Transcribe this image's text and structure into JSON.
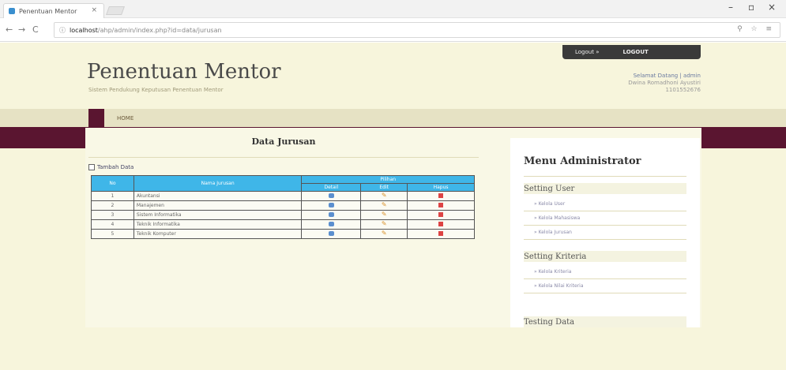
{
  "browser": {
    "tab_title": "Penentuan Mentor",
    "tab_close": "×",
    "url_host": "localhost",
    "url_path": "/ahp/admin/index.php?id=data/jurusan",
    "nav_back": "←",
    "nav_forward": "→",
    "nav_reload": "C",
    "info_icon": "ⓘ",
    "omni_icons": "⚲ ☆ ≡",
    "win_min": "–",
    "win_max": "▫",
    "win_close": "×"
  },
  "site": {
    "title": "Penentuan Mentor",
    "subtitle": "Sistem Pendukung Keputusan Penentuan Mentor"
  },
  "userbar": {
    "logged_in": "Logout »",
    "logout": "LOGOUT"
  },
  "welcome": {
    "line1": "Selamat Datang | admin",
    "line2": "Dwina Romadhoni Ayustiri",
    "line3": "1101552676"
  },
  "nav": {
    "home": "HOME"
  },
  "main": {
    "title": "Data Jurusan",
    "add_label": "Tambah Data",
    "headers": {
      "no": "No",
      "nama": "Nama Jurusan",
      "pilihan": "Pilihan",
      "detail": "Detail",
      "edit": "Edit",
      "hapus": "Hapus"
    },
    "rows": [
      {
        "no": "1",
        "nama": "Akuntansi"
      },
      {
        "no": "2",
        "nama": "Manajemen"
      },
      {
        "no": "3",
        "nama": "Sistem Informatika"
      },
      {
        "no": "4",
        "nama": "Teknik Informatika"
      },
      {
        "no": "5",
        "nama": "Teknik Komputer"
      }
    ]
  },
  "sidebar": {
    "title": "Menu Administrator",
    "sections": [
      {
        "title": "Setting User",
        "items": [
          "» Kelola User",
          "» Kelola Mahasiswa",
          "» Kelola Jurusan"
        ]
      },
      {
        "title": "Setting Kriteria",
        "items": [
          "» Kelola Kriteria",
          "» Kelola Nilai Kriteria"
        ]
      },
      {
        "title": "Testing Data",
        "items": []
      }
    ]
  }
}
